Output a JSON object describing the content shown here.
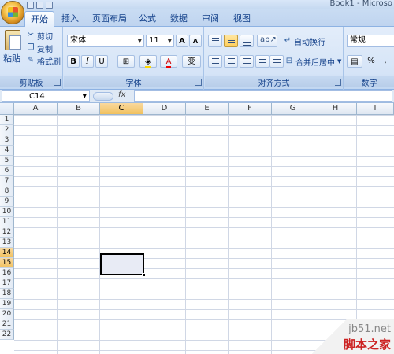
{
  "window": {
    "title": "Book1 - Microso"
  },
  "tabs": [
    "开始",
    "插入",
    "页面布局",
    "公式",
    "数据",
    "审阅",
    "视图"
  ],
  "active_tab": "开始",
  "clipboard": {
    "paste": "粘贴",
    "cut": "剪切",
    "copy": "复制",
    "format_painter": "格式刷",
    "label": "剪贴板"
  },
  "font": {
    "name": "宋体",
    "size": "11",
    "grow": "A",
    "shrink": "A",
    "bold": "B",
    "italic": "I",
    "underline": "U",
    "label": "字体",
    "wen": "变"
  },
  "alignment": {
    "wrap_text": "自动换行",
    "merge_center": "合并后居中",
    "label": "对齐方式"
  },
  "number": {
    "format": "常规",
    "percent": "%",
    "comma": ",",
    "label": "数字"
  },
  "formula_bar": {
    "cell_ref": "C14",
    "fx": "fx",
    "content": ""
  },
  "columns": [
    "A",
    "B",
    "C",
    "D",
    "E",
    "F",
    "G",
    "H",
    "I"
  ],
  "rows": [
    "1",
    "2",
    "3",
    "4",
    "5",
    "6",
    "7",
    "8",
    "9",
    "10",
    "11",
    "12",
    "13",
    "14",
    "15",
    "16",
    "17",
    "18",
    "19",
    "20",
    "21",
    "22"
  ],
  "selected_column": "C",
  "selected_rows": [
    "14",
    "15"
  ],
  "watermark": {
    "url": "jb51.net",
    "name": "脚本之家"
  },
  "colors": {
    "accent": "#15428b",
    "selection_header": "#f1c15f",
    "ribbon": "#d5e4f7"
  }
}
